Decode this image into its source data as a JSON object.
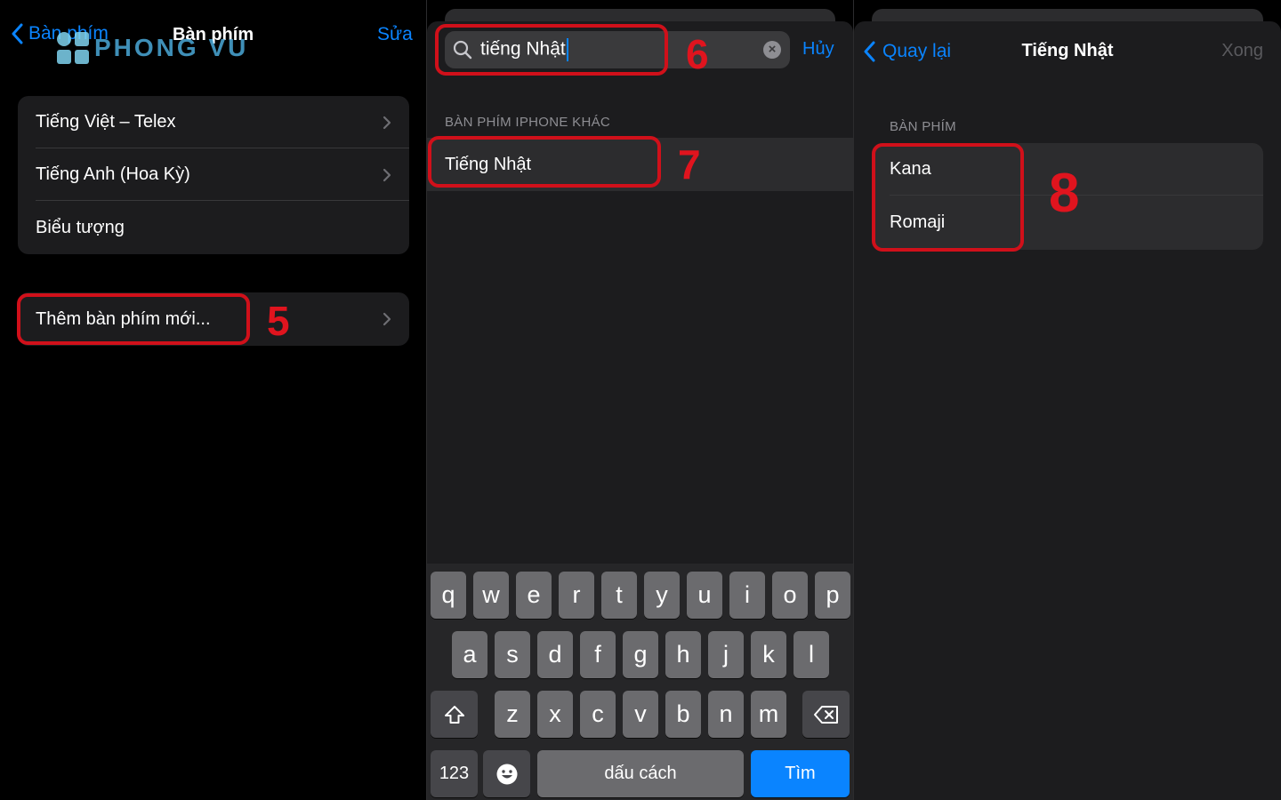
{
  "panel1": {
    "nav_back": "Bàn phím",
    "nav_title": "Bàn phím",
    "nav_edit": "Sửa",
    "watermark": "PHONG VU",
    "keyboards": [
      "Tiếng Việt – Telex",
      "Tiếng Anh (Hoa Kỳ)",
      "Biểu tượng"
    ],
    "add_keyboard": "Thêm bàn phím mới...",
    "step": "5"
  },
  "panel2": {
    "search_value": "tiếng Nhật",
    "cancel": "Hủy",
    "section": "BÀN PHÍM IPHONE KHÁC",
    "result": "Tiếng Nhật",
    "step_search": "6",
    "step_result": "7",
    "keyboard": {
      "row1": [
        "q",
        "w",
        "e",
        "r",
        "t",
        "y",
        "u",
        "i",
        "o",
        "p"
      ],
      "row2": [
        "a",
        "s",
        "d",
        "f",
        "g",
        "h",
        "j",
        "k",
        "l"
      ],
      "row3": [
        "z",
        "x",
        "c",
        "v",
        "b",
        "n",
        "m"
      ],
      "numbers": "123",
      "space": "dấu cách",
      "search": "Tìm"
    }
  },
  "panel3": {
    "back": "Quay lại",
    "title": "Tiếng Nhật",
    "done": "Xong",
    "section": "BÀN PHÍM",
    "options": [
      "Kana",
      "Romaji"
    ],
    "step": "8"
  },
  "colors": {
    "accent": "#0a84ff",
    "callout": "#d0101a",
    "group_bg": "#1c1c1e"
  }
}
